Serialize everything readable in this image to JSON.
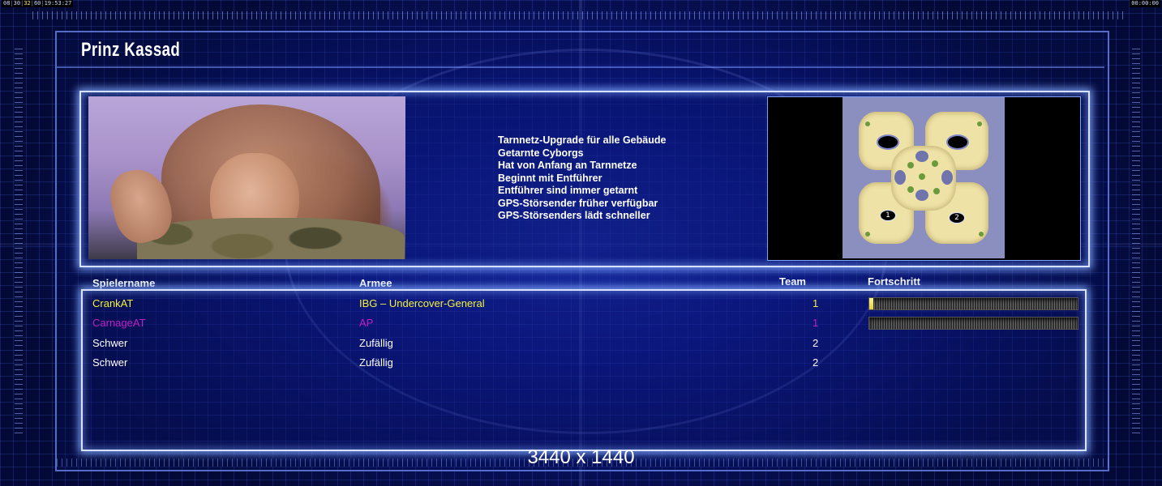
{
  "hud": {
    "left_a": "08",
    "left_b": "30",
    "left_c": "32",
    "left_d": "60",
    "left_time": "19:53:27",
    "right_time": "00:00:00"
  },
  "title": "Prinz Kassad",
  "perks": [
    "Tarnnetz-Upgrade für alle Gebäude",
    "Getarnte Cyborgs",
    "Hat von Anfang an Tarnnetze",
    "Beginnt mit Entführer",
    "Entführer sind immer getarnt",
    "GPS-Störsender früher verfügbar",
    "GPS-Störsenders lädt schneller"
  ],
  "minimap": {
    "slots": [
      "1",
      "2"
    ]
  },
  "columns": {
    "player": "Spielername",
    "army": "Armee",
    "team": "Team",
    "progress": "Fortschritt"
  },
  "players": [
    {
      "name": "CrankAT",
      "army": "IBG – Undercover-General",
      "team": "1",
      "color": "#f2f23a",
      "progress": 0.02
    },
    {
      "name": "CarnageAT",
      "army": "AP",
      "team": "1",
      "color": "#c21fc2",
      "progress": 0.0
    },
    {
      "name": "Schwer",
      "army": "Zufällig",
      "team": "2",
      "color": "#ffffff"
    },
    {
      "name": "Schwer",
      "army": "Zufällig",
      "team": "2",
      "color": "#ffffff"
    }
  ],
  "resolution": "3440 x 1440"
}
